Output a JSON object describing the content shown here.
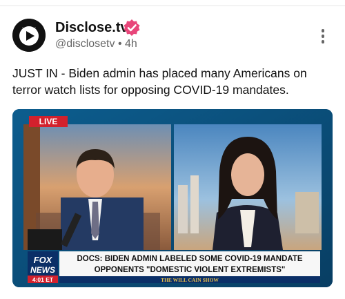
{
  "post": {
    "author_name": "Disclose.tv",
    "handle": "@disclosetv",
    "separator": "•",
    "time": "4h",
    "text": "JUST IN - Biden admin has placed many Americans on terror watch lists for opposing COVID-19 mandates."
  },
  "media": {
    "live_badge": "LIVE",
    "logo_line1": "FOX",
    "logo_line2": "NEWS",
    "clock": "4:01 ET",
    "headline_line1": "DOCS: BIDEN ADMIN LABELED SOME COVID-19 MANDATE",
    "headline_line2": "OPPONENTS \"DOMESTIC VIOLENT EXTREMISTS\"",
    "show_tag": "THE WILL CAIN SHOW"
  },
  "icons": {
    "avatar": "disclose-tv-logo-icon",
    "verified": "verified-badge-icon",
    "more": "more-vertical-icon"
  },
  "colors": {
    "verified": "#e8467a",
    "fox_blue": "#0b2f67",
    "live_red": "#d3212d"
  }
}
